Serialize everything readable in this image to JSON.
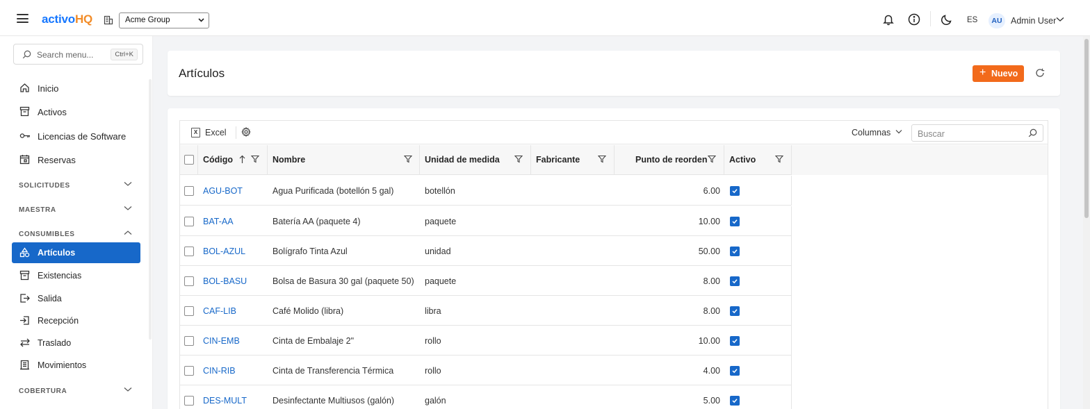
{
  "header": {
    "logo_a": "activo",
    "logo_b": "HQ",
    "org_selected": "Acme Group",
    "lang": "ES",
    "avatar_initials": "AU",
    "user_name": "Admin User"
  },
  "sidebar": {
    "search_placeholder": "Search menu...",
    "search_shortcut": "Ctrl+K",
    "items": [
      {
        "label": "Inicio",
        "icon": "home-icon"
      },
      {
        "label": "Activos",
        "icon": "archive-icon"
      },
      {
        "label": "Licencias de Software",
        "icon": "key-icon"
      },
      {
        "label": "Reservas",
        "icon": "calendar-icon"
      }
    ],
    "sections": [
      {
        "label": "SOLICITUDES",
        "expanded": false
      },
      {
        "label": "MAESTRA",
        "expanded": false
      },
      {
        "label": "CONSUMIBLES",
        "expanded": true
      },
      {
        "label": "COBERTURA",
        "expanded": false
      }
    ],
    "consumibles_items": [
      {
        "label": "Artículos",
        "icon": "shapes-icon",
        "active": true
      },
      {
        "label": "Existencias",
        "icon": "archive-icon"
      },
      {
        "label": "Salida",
        "icon": "exit-icon"
      },
      {
        "label": "Recepción",
        "icon": "enter-icon"
      },
      {
        "label": "Traslado",
        "icon": "transfer-icon"
      },
      {
        "label": "Movimientos",
        "icon": "ledger-icon"
      }
    ]
  },
  "page": {
    "title": "Artículos",
    "new_button": "Nuevo",
    "new_plus": "+"
  },
  "toolbar": {
    "excel_label": "Excel",
    "excel_icon_letter": "X",
    "columns_label": "Columnas",
    "search_placeholder": "Buscar"
  },
  "table": {
    "columns": [
      "Código",
      "Nombre",
      "Unidad de medida",
      "Fabricante",
      "Punto de reorden",
      "Activo"
    ],
    "sort": {
      "column": "Código",
      "direction": "asc"
    },
    "rows": [
      {
        "code": "AGU-BOT",
        "name": "Agua Purificada (botellón 5 gal)",
        "unit": "botellón",
        "maker": "",
        "reorder": "6.00",
        "active": true
      },
      {
        "code": "BAT-AA",
        "name": "Batería AA (paquete 4)",
        "unit": "paquete",
        "maker": "",
        "reorder": "10.00",
        "active": true
      },
      {
        "code": "BOL-AZUL",
        "name": "Bolígrafo Tinta Azul",
        "unit": "unidad",
        "maker": "",
        "reorder": "50.00",
        "active": true
      },
      {
        "code": "BOL-BASU",
        "name": "Bolsa de Basura 30 gal (paquete 50)",
        "unit": "paquete",
        "maker": "",
        "reorder": "8.00",
        "active": true
      },
      {
        "code": "CAF-LIB",
        "name": "Café Molido (libra)",
        "unit": "libra",
        "maker": "",
        "reorder": "8.00",
        "active": true
      },
      {
        "code": "CIN-EMB",
        "name": "Cinta de Embalaje 2\"",
        "unit": "rollo",
        "maker": "",
        "reorder": "10.00",
        "active": true
      },
      {
        "code": "CIN-RIB",
        "name": "Cinta de Transferencia Térmica",
        "unit": "rollo",
        "maker": "",
        "reorder": "4.00",
        "active": true
      },
      {
        "code": "DES-MULT",
        "name": "Desinfectante Multiusos (galón)",
        "unit": "galón",
        "maker": "",
        "reorder": "5.00",
        "active": true
      }
    ]
  },
  "colors": {
    "primary": "#1768c9",
    "accent": "#f26a1b",
    "logo_blue": "#1677ff",
    "logo_orange": "#f28c28"
  }
}
